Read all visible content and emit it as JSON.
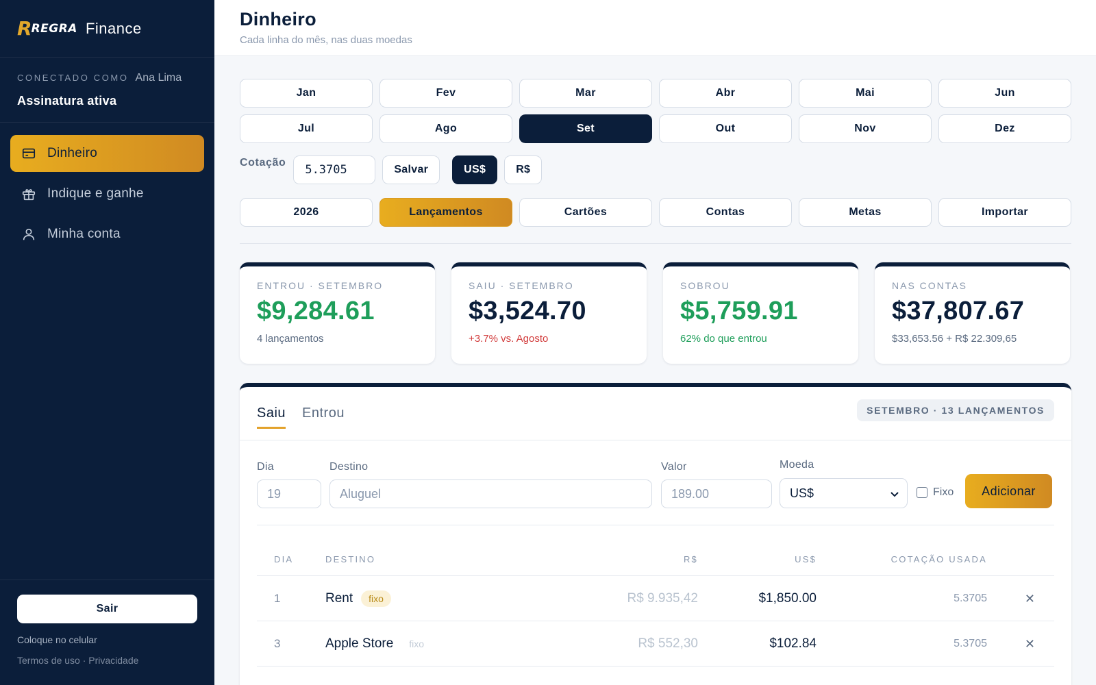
{
  "brand": {
    "mark": "R",
    "regra": "REGRA",
    "name": "Finance"
  },
  "user": {
    "caption": "CONECTADO COMO",
    "name": "Ana Lima",
    "status": "Assinatura ativa"
  },
  "nav": [
    {
      "label": "Dinheiro",
      "icon": "card-icon",
      "active": true
    },
    {
      "label": "Indique e ganhe",
      "icon": "gift-icon",
      "active": false
    },
    {
      "label": "Minha conta",
      "icon": "user-icon",
      "active": false
    }
  ],
  "sidebar_bottom": {
    "logout": "Sair",
    "install": "Coloque no celular",
    "legal": "Termos de uso · Privacidade"
  },
  "header": {
    "title": "Dinheiro",
    "subtitle": "Cada linha do mês, nas duas moedas"
  },
  "months": [
    "Jan",
    "Fev",
    "Mar",
    "Abr",
    "Mai",
    "Jun",
    "Jul",
    "Ago",
    "Set",
    "Out",
    "Nov",
    "Dez"
  ],
  "selected_month": "Set",
  "rate": {
    "label": "Cotação",
    "value": "5.3705",
    "save": "Salvar",
    "currencies": [
      "US$",
      "R$"
    ],
    "selected_currency": "US$"
  },
  "sections": [
    "2026",
    "Lançamentos",
    "Cartões",
    "Contas",
    "Metas",
    "Importar"
  ],
  "selected_section": "Lançamentos",
  "cards": [
    {
      "caption": "ENTROU · SETEMBRO",
      "value": "$9,284.61",
      "note": "4 lançamentos",
      "value_color": "green",
      "note_color": "muted"
    },
    {
      "caption": "SAIU · SETEMBRO",
      "value": "$3,524.70",
      "note": "+3.7% vs. Agosto",
      "value_color": "dark",
      "note_color": "red"
    },
    {
      "caption": "SOBROU",
      "value": "$5,759.91",
      "note": "62% do que entrou",
      "value_color": "green",
      "note_color": "green"
    },
    {
      "caption": "NAS CONTAS",
      "value": "$37,807.67",
      "note": "$33,653.56 + R$ 22.309,65",
      "value_color": "dark",
      "note_color": "muted"
    }
  ],
  "panel": {
    "tabs": [
      "Saiu",
      "Entrou"
    ],
    "active_tab": "Saiu",
    "badge": "SETEMBRO · 13 LANÇAMENTOS",
    "form": {
      "day_label": "Dia",
      "day_placeholder": "19",
      "dest_label": "Destino",
      "dest_placeholder": "Aluguel",
      "value_label": "Valor",
      "value_placeholder": "189.00",
      "currency_label": "Moeda",
      "currency_value": "US$",
      "fixed_label": "Fixo",
      "add_label": "Adicionar"
    },
    "columns": [
      "DIA",
      "DESTINO",
      "R$",
      "US$",
      "COTAÇÃO USADA"
    ],
    "rows": [
      {
        "day": "1",
        "dest": "Rent",
        "tag": "fixo",
        "fixed": true,
        "brl": "R$ 9.935,42",
        "usd": "$1,850.00",
        "rate": "5.3705"
      },
      {
        "day": "3",
        "dest": "Apple Store",
        "tag": "fixo",
        "fixed": false,
        "brl": "R$ 552,30",
        "usd": "$102.84",
        "rate": "5.3705"
      }
    ]
  },
  "colors": {
    "navy": "#0b1e3a",
    "gold": "#e3a22b",
    "green": "#1e9e5a",
    "red": "#d23c3c"
  }
}
